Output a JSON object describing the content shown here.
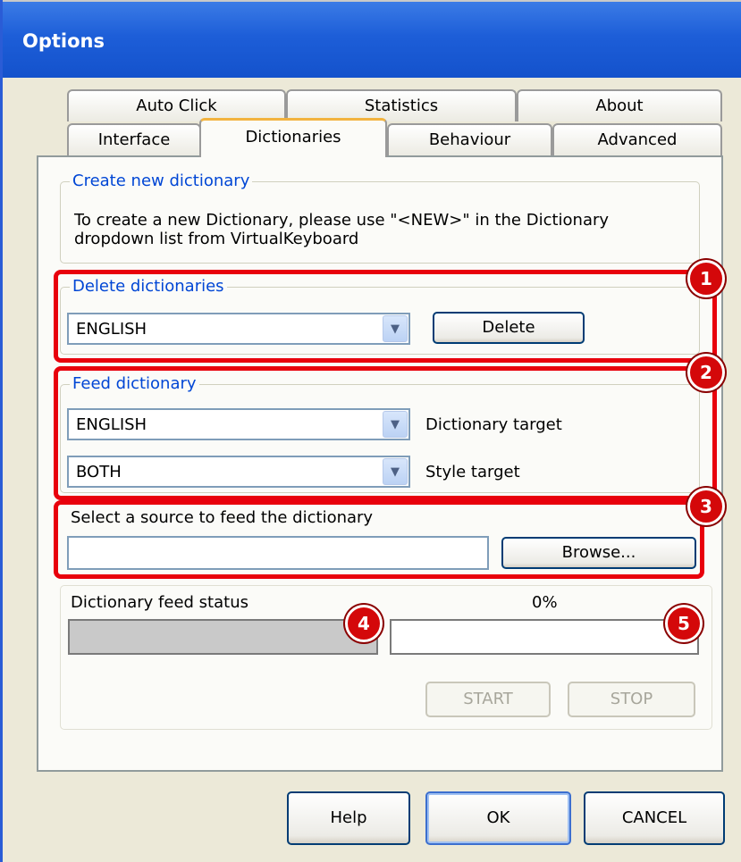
{
  "window": {
    "title": "Options"
  },
  "tabs": {
    "row_top": [
      "Auto Click",
      "Statistics",
      "About"
    ],
    "row_bottom": [
      "Interface",
      "Dictionaries",
      "Behaviour",
      "Advanced"
    ],
    "active": "Dictionaries"
  },
  "create_new": {
    "legend": "Create new dictionary",
    "text_line1": "To create a new Dictionary, please use \"<NEW>\" in the Dictionary",
    "text_line2": "dropdown list from VirtualKeyboard"
  },
  "delete_dictionaries": {
    "legend": "Delete dictionaries",
    "selected": "ENGLISH",
    "delete_label": "Delete"
  },
  "feed_dictionary": {
    "legend": "Feed dictionary",
    "dictionary_selected": "ENGLISH",
    "dictionary_target_label": "Dictionary target",
    "style_selected": "BOTH",
    "style_target_label": "Style target"
  },
  "source": {
    "label": "Select a source to feed the dictionary",
    "path_value": "",
    "browse_label": "Browse..."
  },
  "status": {
    "label": "Dictionary feed status",
    "percent_text": "0%",
    "progress_fraction": 0,
    "start_label": "START",
    "stop_label": "STOP"
  },
  "annotations": [
    "1",
    "2",
    "3",
    "4",
    "5"
  ],
  "footer": {
    "help_label": "Help",
    "ok_label": "OK",
    "cancel_label": "CANCEL"
  },
  "colors": {
    "titlebar": "#1d5ed8",
    "legend_text": "#0046d5",
    "annotation_red": "#e8000c",
    "active_tab_highlight": "#f2b33f"
  }
}
